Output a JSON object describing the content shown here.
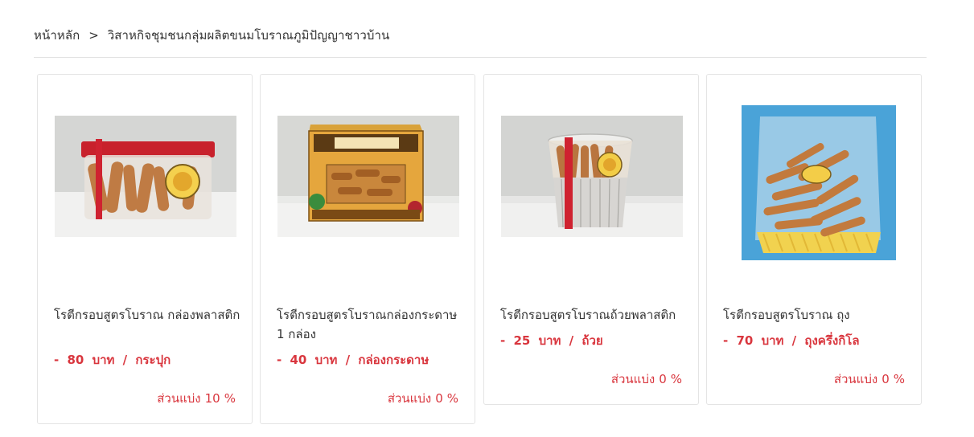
{
  "breadcrumb": {
    "home": "หน้าหลัก",
    "separator": ">",
    "current": "วิสาหกิจชุมชนกลุ่มผลิตขนมโบราณภูมิปัญญาชาวบ้าน"
  },
  "products": [
    {
      "name": "โรตีกรอบสูตรโบราณ กล่องพลาสติก",
      "price_prefix": "-",
      "price": "80",
      "currency": "บาท",
      "per_sep": "/",
      "unit": "กระปุก",
      "share_label": "ส่วนแบ่ง",
      "share_value": "10",
      "share_unit": "%",
      "image": "plastic-box-icon"
    },
    {
      "name": "โรตีกรอบสูตรโบราณกล่องกระดาษ 1 กล่อง",
      "price_prefix": "-",
      "price": "40",
      "currency": "บาท",
      "per_sep": "/",
      "unit": "กล่องกระดาษ",
      "share_label": "ส่วนแบ่ง",
      "share_value": "0",
      "share_unit": "%",
      "image": "paper-box-icon"
    },
    {
      "name": "โรตีกรอบสูตรโบราณถ้วยพลาสติก",
      "price_prefix": "-",
      "price": "25",
      "currency": "บาท",
      "per_sep": "/",
      "unit": "ถ้วย",
      "share_label": "ส่วนแบ่ง",
      "share_value": "0",
      "share_unit": "%",
      "image": "plastic-cup-icon"
    },
    {
      "name": "โรตีกรอบสูตรโบราณ ถุง",
      "price_prefix": "-",
      "price": "70",
      "currency": "บาท",
      "per_sep": "/",
      "unit": "ถุงครึ่งกิโล",
      "share_label": "ส่วนแบ่ง",
      "share_value": "0",
      "share_unit": "%",
      "image": "plastic-bag-icon"
    }
  ],
  "colors": {
    "accent": "#d9363e",
    "text": "#333333",
    "border": "#e4e4e4"
  }
}
